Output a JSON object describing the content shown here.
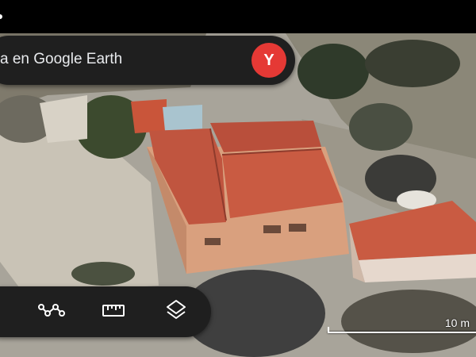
{
  "search": {
    "text": "a en Google Earth"
  },
  "account": {
    "initial": "Y",
    "color": "#e53935"
  },
  "toolbar": {
    "items": [
      {
        "icon": "measure-path-icon"
      },
      {
        "icon": "ruler-icon"
      },
      {
        "icon": "layers-icon"
      }
    ]
  },
  "scale": {
    "label": "10 m"
  },
  "colors": {
    "panel": "#1f1f1f",
    "roof": "#c0553f"
  }
}
